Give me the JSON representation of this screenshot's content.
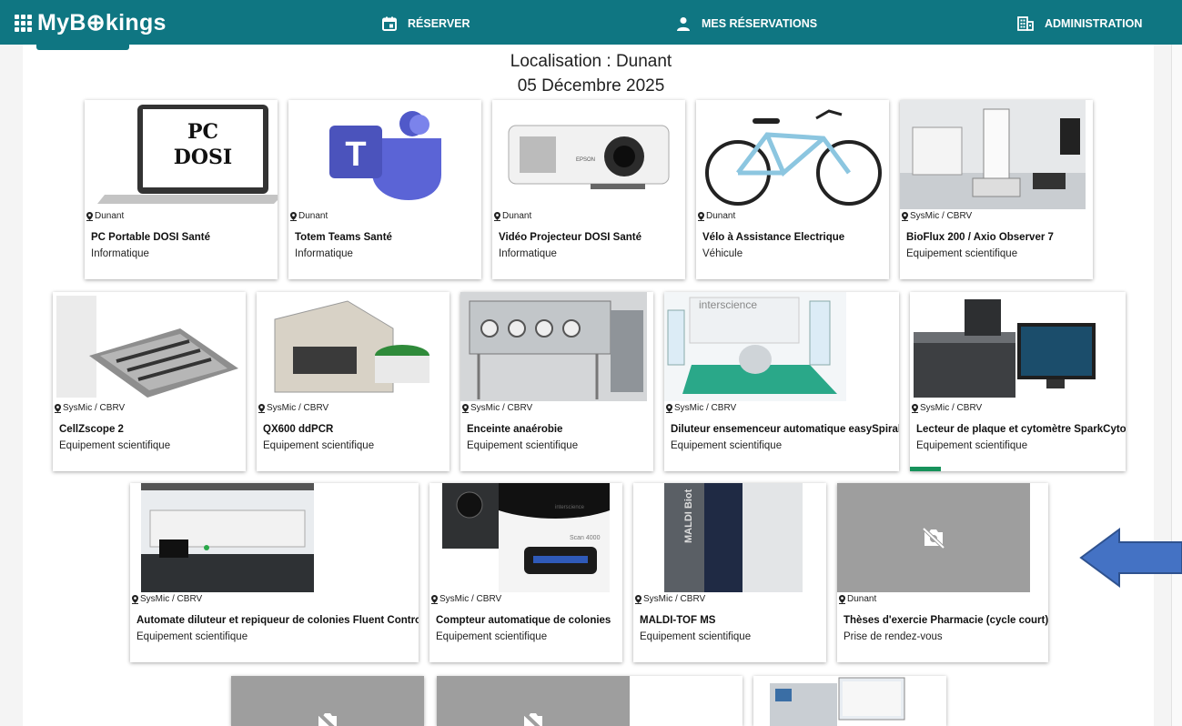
{
  "app": {
    "logo": "MyB⊕kings"
  },
  "nav": {
    "reserve": "RÉSERVER",
    "my_bookings": "MES RÉSERVATIONS",
    "admin": "ADMINISTRATION"
  },
  "header": {
    "location": "Localisation : Dunant",
    "date": "05 Décembre 2025"
  },
  "cards": [
    {
      "loc": "Dunant",
      "name": "PC Portable DOSI Santé",
      "cat": "Informatique",
      "image_text": [
        "PC",
        "DOSI"
      ]
    },
    {
      "loc": "Dunant",
      "name": "Totem Teams Santé",
      "cat": "Informatique",
      "image_text": [
        "T"
      ]
    },
    {
      "loc": "Dunant",
      "name": "Vidéo Projecteur DOSI Santé",
      "cat": "Informatique",
      "image_text": [
        "EPSON"
      ]
    },
    {
      "loc": "Dunant",
      "name": "Vélo à Assistance Electrique",
      "cat": "Véhicule"
    },
    {
      "loc": "SysMic / CBRV",
      "name": "BioFlux 200 / Axio Observer 7",
      "cat": "Equipement scientifique"
    },
    {
      "loc": "SysMic / CBRV",
      "name": "CellZscope 2",
      "cat": "Equipement scientifique"
    },
    {
      "loc": "SysMic / CBRV",
      "name": "QX600 ddPCR",
      "cat": "Equipement scientifique"
    },
    {
      "loc": "SysMic / CBRV",
      "name": "Enceinte anaérobie",
      "cat": "Equipement scientifique"
    },
    {
      "loc": "SysMic / CBRV",
      "name": "Diluteur ensemenceur automatique easySpiral",
      "cat": "Equipement scientifique",
      "image_text": [
        "interscience"
      ]
    },
    {
      "loc": "SysMic / CBRV",
      "name": "Lecteur de plaque et cytomètre SparkCyto",
      "cat": "Equipement scientifique"
    },
    {
      "loc": "SysMic / CBRV",
      "name": "Automate diluteur et repiqueur de colonies Fluent Control",
      "cat": "Equipement scientifique"
    },
    {
      "loc": "SysMic / CBRV",
      "name": "Compteur automatique de colonies",
      "cat": "Equipement scientifique",
      "image_text": [
        "interscience",
        "Scan 4000"
      ]
    },
    {
      "loc": "SysMic / CBRV",
      "name": "MALDI-TOF MS",
      "cat": "Equipement scientifique",
      "image_text": [
        "MALDI Biot"
      ]
    },
    {
      "loc": "Dunant",
      "name": "Thèses d'exercie Pharmacie (cycle court)",
      "cat": "Prise de rendez-vous"
    }
  ]
}
